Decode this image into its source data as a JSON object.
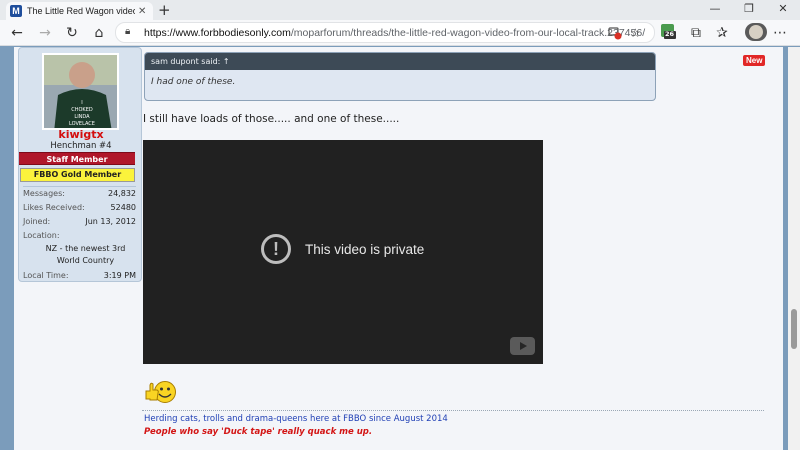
{
  "browser": {
    "tab_title": "The Little Red Wagon video from",
    "tab_favicon": "M",
    "url_domain": "https://www.forbbodiesonly.com",
    "url_path": "/moparforum/threads/the-little-red-wagon-video-from-our-local-track.237456/",
    "extension_badge": "26",
    "window_controls": [
      "—",
      "❐",
      "✕"
    ]
  },
  "user": {
    "name": "kiwigtx",
    "title": "Henchman #4",
    "staff_banner": "Staff Member",
    "gold_banner": "FBBO Gold Member",
    "avatar_shirt_text": [
      "I",
      "CHOKED",
      "LINDA",
      "LOVELACE"
    ],
    "stats": [
      {
        "label": "Messages:",
        "value": "24,832"
      },
      {
        "label": "Likes Received:",
        "value": "52480"
      },
      {
        "label": "Joined:",
        "value": "Jun 13, 2012"
      }
    ],
    "location_label": "Location:",
    "location_value": "NZ - the newest 3rd World Country",
    "local_time_label": "Local Time:",
    "local_time_value": "3:19 PM"
  },
  "post": {
    "new_badge": "New",
    "quote_author": "sam dupont said: ↑",
    "quote_text": "I had one of these.",
    "text": "I still have loads of those..... and one of these.....",
    "video_message": "This video is private",
    "video_icon": "!"
  },
  "signature": {
    "line1": "Herding cats, trolls and drama-queens here at FBBO since August 2014",
    "line2": "People who say 'Duck tape' really quack me up."
  }
}
